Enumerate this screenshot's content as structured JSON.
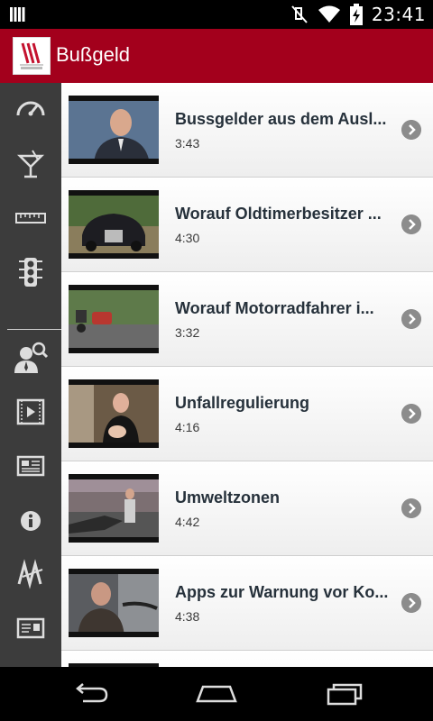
{
  "status_bar": {
    "time": "23:41",
    "icons": [
      "notification-icon",
      "mute-icon",
      "wifi-icon",
      "battery-charging-icon"
    ]
  },
  "action_bar": {
    "title": "Bußgeld",
    "logo": "app-logo"
  },
  "sidebar": {
    "items": [
      {
        "icon": "speedometer-icon"
      },
      {
        "icon": "cocktail-icon"
      },
      {
        "icon": "ruler-icon"
      },
      {
        "icon": "traffic-light-icon"
      },
      {
        "icon": "lawyer-search-icon"
      },
      {
        "icon": "video-icon"
      },
      {
        "icon": "newspaper-icon"
      },
      {
        "icon": "info-icon"
      },
      {
        "icon": "brand-logo-icon"
      },
      {
        "icon": "contact-card-icon"
      }
    ]
  },
  "videos": [
    {
      "title": "Bussgelder aus dem Ausl...",
      "duration": "3:43"
    },
    {
      "title": "Worauf Oldtimerbesitzer ...",
      "duration": "4:30"
    },
    {
      "title": "Worauf Motorradfahrer i...",
      "duration": "3:32"
    },
    {
      "title": "Unfallregulierung",
      "duration": "4:16"
    },
    {
      "title": "Umweltzonen",
      "duration": "4:42"
    },
    {
      "title": "Apps zur Warnung vor Ko...",
      "duration": "4:38"
    }
  ],
  "nav_bar": {
    "buttons": [
      "back-icon",
      "home-icon",
      "recent-apps-icon"
    ]
  }
}
